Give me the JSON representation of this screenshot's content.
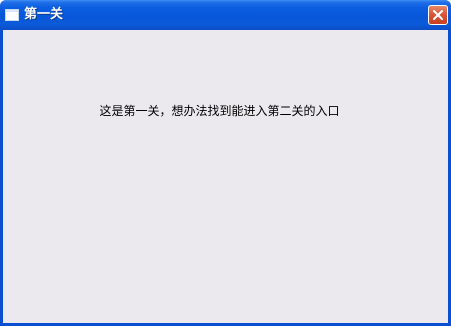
{
  "window": {
    "title": "第一关",
    "message": "这是第一关，想办法找到能进入第二关的入口"
  },
  "icons": {
    "window_icon": "window-icon",
    "close": "close-icon"
  },
  "colors": {
    "titlebar": "#0857da",
    "client_background": "#ebe9ed",
    "close_button": "#d9563a"
  }
}
